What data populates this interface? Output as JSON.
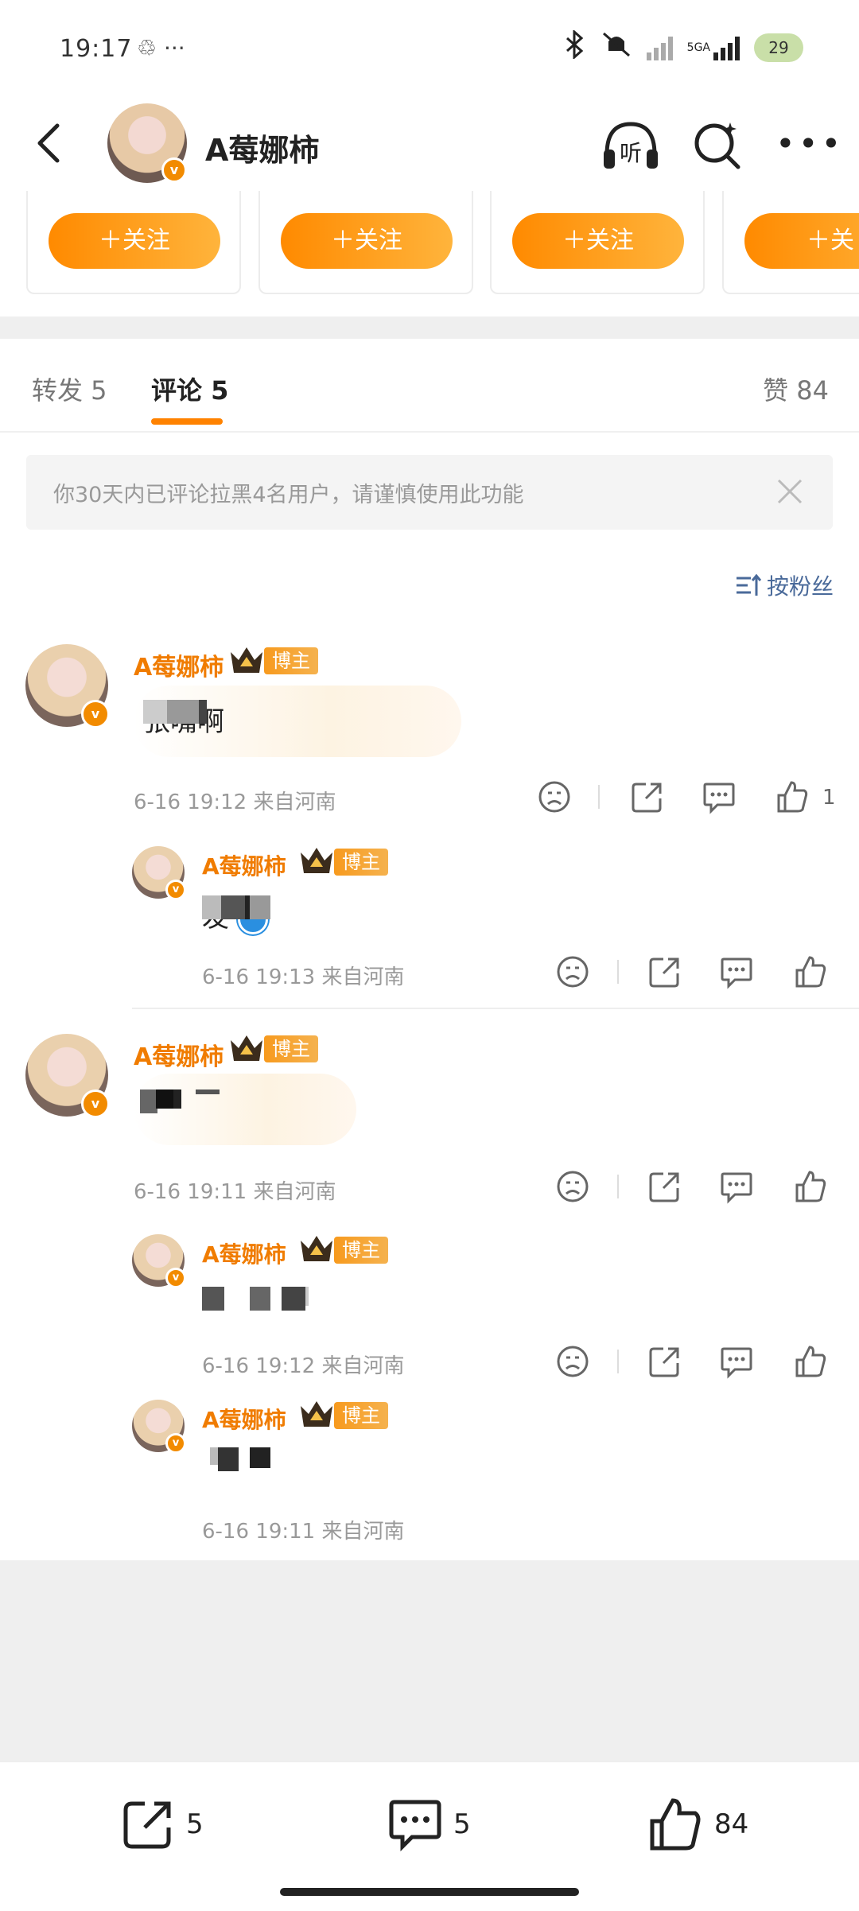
{
  "status_bar": {
    "time": "19:17",
    "left_icons": "♲ ···",
    "network": "5GA",
    "battery": "29"
  },
  "nav": {
    "title": "A莓娜柿",
    "listen_label": "听"
  },
  "follow_cards": [
    {
      "label": "＋关注"
    },
    {
      "label": "＋关注"
    },
    {
      "label": "＋关注"
    },
    {
      "label": "＋关"
    }
  ],
  "tabs": {
    "repost": "转发 5",
    "comments": "评论 5",
    "likes": "赞 84"
  },
  "notice": {
    "text": "你30天内已评论拉黑4名用户，请谨慎使用此功能"
  },
  "sort": {
    "label": "按粉丝"
  },
  "comments": [
    {
      "name": "A莓娜柿",
      "badge": "博主",
      "text_visible": "张嘴啊",
      "meta": "6-16 19:12  来自河南",
      "like_count": "1"
    },
    {
      "name": "A莓娜柿",
      "badge": "博主",
      "text_visible": "发",
      "meta": "6-16 19:13  来自河南"
    },
    {
      "name": "A莓娜柿",
      "badge": "博主",
      "text_visible": "",
      "meta": "6-16 19:11  来自河南"
    },
    {
      "name": "A莓娜柿",
      "badge": "博主",
      "text_visible": "",
      "meta": "6-16 19:12  来自河南"
    },
    {
      "name": "A莓娜柿",
      "badge": "博主",
      "text_visible": "",
      "meta": "6-16 19:11  来自河南"
    }
  ],
  "bottom_bar": {
    "repost_count": "5",
    "comment_count": "5",
    "like_count": "84"
  },
  "colors": {
    "accent": "#ff8200",
    "name_orange": "#f07c00",
    "sort_blue": "#4a6a9a"
  }
}
